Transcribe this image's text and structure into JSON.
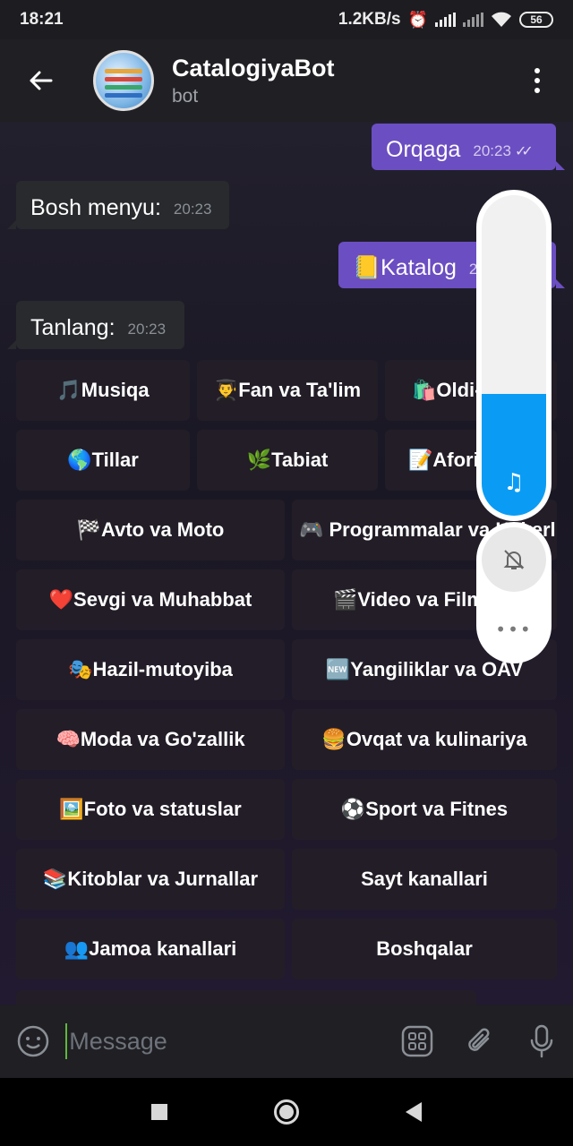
{
  "status_bar": {
    "time": "18:21",
    "speed": "1.2KB/s",
    "battery": "56"
  },
  "header": {
    "title": "CatalogiyaBot",
    "subtitle": "bot"
  },
  "messages": [
    {
      "text": "Orqaga",
      "time": "20:23",
      "direction": "out"
    },
    {
      "text": "Bosh menyu:",
      "time": "20:23",
      "direction": "in"
    },
    {
      "text": "📒Katalog",
      "time": "20:23",
      "direction": "out"
    },
    {
      "text": "Tanlang:",
      "time": "20:23",
      "direction": "in"
    }
  ],
  "keyboard": {
    "rows": [
      [
        "🎵Musiqa",
        "👨‍🎓Fan va Ta'lim",
        "🛍️Oldi-sotdi"
      ],
      [
        "🌎Tillar",
        "🌿Tabiat",
        "📝Aforizmlar"
      ],
      [
        "🏁Avto va Moto",
        "🎮 Programmalar va Hakerlik"
      ],
      [
        "❤️Sevgi va Muhabbat",
        "🎬Video va Filmlar"
      ],
      [
        "🎭Hazil-mutoyiba",
        "🆕Yangiliklar va OAV"
      ],
      [
        "🧠Moda va Go'zallik",
        "🍔Ovqat va kulinariya"
      ],
      [
        "🖼️Foto va statuslar",
        "⚽Sport va Fitnes"
      ],
      [
        "📚Kitoblar va Jurnallar",
        "Sayt kanallari"
      ],
      [
        "👥Jamoa kanallari",
        "Boshqalar"
      ]
    ]
  },
  "volume": {
    "level_fraction": 0.38,
    "note_icon": "music-note-icon",
    "mute_icon": "bell-off-icon",
    "more": "•••"
  },
  "input": {
    "placeholder": "Message"
  },
  "colors": {
    "outgoing": "#6b4ec2",
    "incoming": "#282a2d",
    "accent": "#0a9cf5",
    "header": "#1f1f24"
  }
}
